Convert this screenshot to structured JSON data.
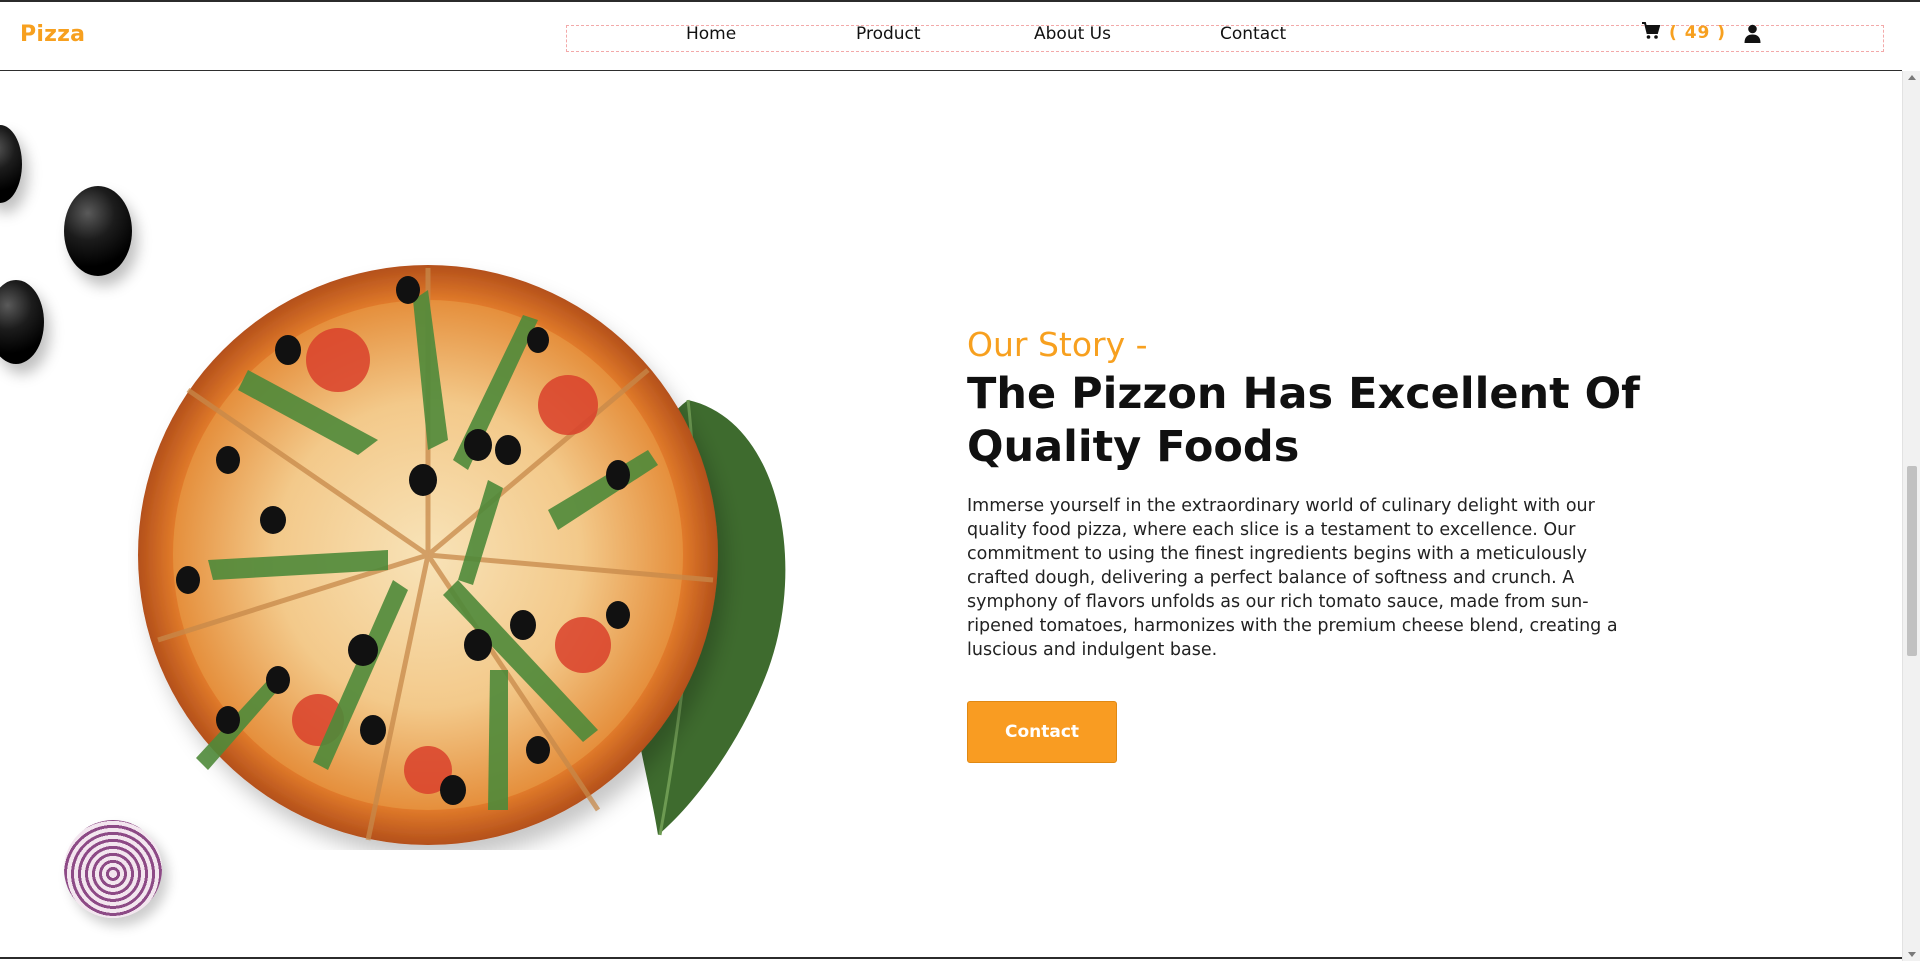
{
  "brand": {
    "logo": "Pizza",
    "accent_color": "#f7a01f"
  },
  "nav": {
    "links": [
      {
        "label": "Home"
      },
      {
        "label": "Product"
      },
      {
        "label": "About Us"
      },
      {
        "label": "Contact"
      }
    ],
    "cart": {
      "icon": "cart-icon",
      "count": "( 49 )"
    },
    "user": {
      "icon": "user-icon"
    }
  },
  "story": {
    "subtitle": "Our Story -",
    "title": "The Pizzon Has Excellent Of Quality Foods",
    "body": "Immerse yourself in the extraordinary world of culinary delight with our quality food pizza, where each slice is a testament to excellence. Our commitment to using the finest ingredients begins with a meticulously crafted dough, delivering a perfect balance of softness and crunch. A symphony of flavors unfolds as our rich tomato sauce, made from sun-ripened tomatoes, harmonizes with the premium cheese blend, creating a luscious and indulgent base.",
    "button_label": "Contact"
  },
  "hero_image": {
    "icon": "pizza-image",
    "decorations": [
      "olive-icon",
      "basil-leaf-icon",
      "onion-icon"
    ]
  }
}
